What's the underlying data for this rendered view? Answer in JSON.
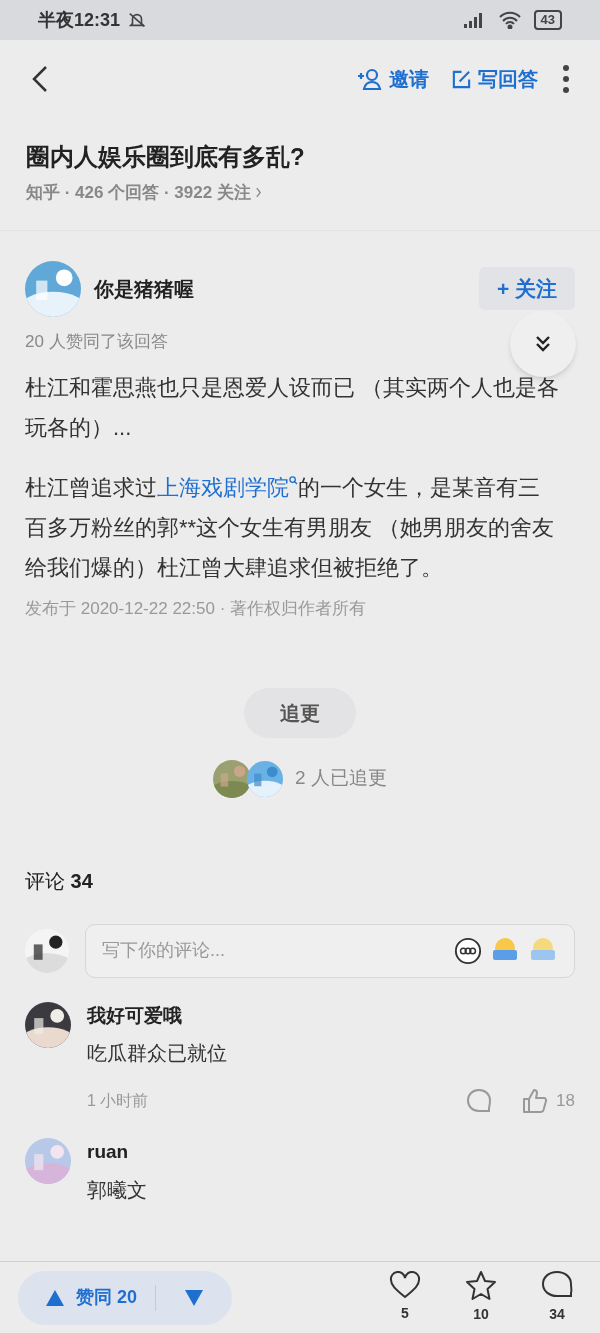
{
  "status_bar": {
    "time": "半夜12:31",
    "battery": "43"
  },
  "nav": {
    "actions": [
      {
        "kind": "invite",
        "label": "邀请"
      },
      {
        "kind": "write",
        "label": "写回答"
      }
    ]
  },
  "question": {
    "title": "圈内人娱乐圈到底有多乱?",
    "meta": "知乎 · 426 个回答 · 3922 关注"
  },
  "answer": {
    "author": "你是猪猪喔",
    "follow_label": "+ 关注",
    "votes_note": "20 人赞同了该回答",
    "paragraphs": [
      {
        "before": "杜江和霍思燕也只是恩爱人设而已 （其实两个人也是各玩各的）..."
      },
      {
        "before": "杜江曾追求过",
        "link": "上海戏剧学院",
        "after": "的一个女生，是某音有三百多万粉丝的郭**这个女生有男朋友 （她男朋友的舍友给我们爆的）杜江曾大肆追求但被拒绝了。"
      }
    ],
    "published": "发布于 2020-12-22 22:50 · 著作权归作者所有"
  },
  "follow_updates": {
    "button": "追更",
    "count": "2 人已追更"
  },
  "comments": {
    "heading": "评论",
    "count": "34",
    "placeholder": "写下你的评论...",
    "items": [
      {
        "name": "我好可爱哦",
        "text": "吃瓜群众已就位",
        "time": "1 小时前",
        "likes": "18"
      },
      {
        "name": "ruan",
        "text": "郭曦文"
      }
    ]
  },
  "bottom_bar": {
    "vote_label": "赞同 20",
    "actions": [
      {
        "kind": "like",
        "count": "5"
      },
      {
        "kind": "star",
        "count": "10"
      },
      {
        "kind": "comment",
        "count": "34"
      }
    ]
  }
}
